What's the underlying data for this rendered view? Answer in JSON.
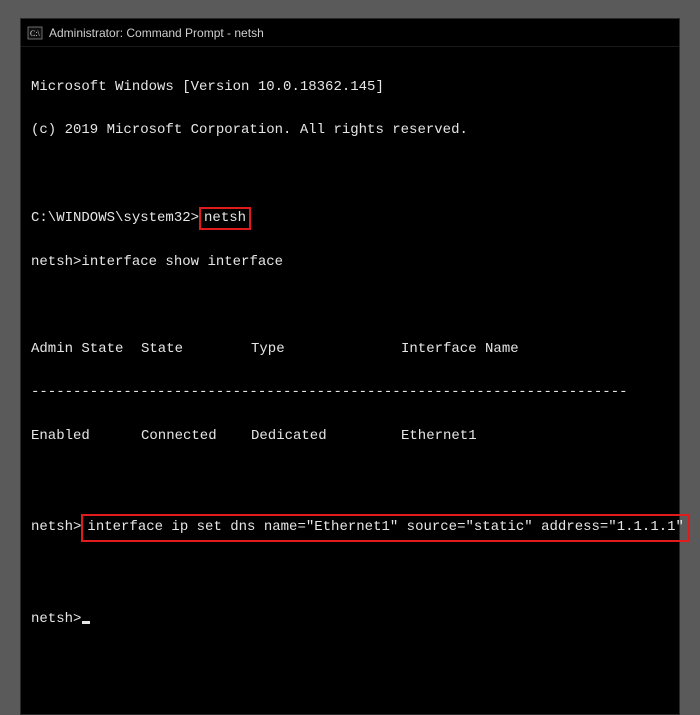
{
  "titlebar": {
    "icon_name": "cmd-icon",
    "title": "Administrator: Command Prompt - netsh"
  },
  "terminal": {
    "version_line": "Microsoft Windows [Version 10.0.18362.145]",
    "copyright_line": "(c) 2019 Microsoft Corporation. All rights reserved.",
    "prompt1_path": "C:\\WINDOWS\\system32>",
    "prompt1_cmd": "netsh",
    "prompt2_path": "netsh>",
    "prompt2_cmd": "interface show interface",
    "table": {
      "headers": {
        "c1": "Admin State",
        "c2": "State",
        "c3": "Type",
        "c4": "Interface Name"
      },
      "divider": "-----------------------------------------------------------------------",
      "row": {
        "c1": "Enabled",
        "c2": "Connected",
        "c3": "Dedicated",
        "c4": "Ethernet1"
      }
    },
    "prompt3_path": "netsh>",
    "prompt3_cmd": "interface ip set dns name=\"Ethernet1\" source=\"static\" address=\"1.1.1.1\"",
    "prompt4_path": "netsh>"
  }
}
